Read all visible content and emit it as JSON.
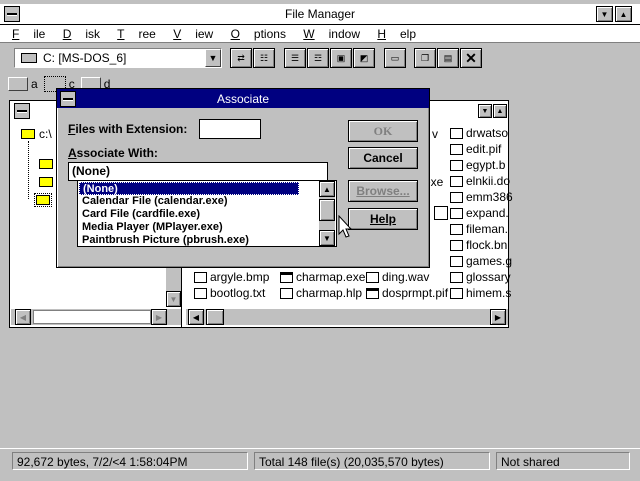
{
  "app": {
    "title": "File Manager"
  },
  "menu": [
    "File",
    "Disk",
    "Tree",
    "View",
    "Options",
    "Window",
    "Help"
  ],
  "menu_underline": [
    "F",
    "D",
    "T",
    "V",
    "O",
    "W",
    "H"
  ],
  "drive_select": {
    "value": "C: [MS-DOS_6]"
  },
  "drive_bar": {
    "drives": [
      "a",
      "c",
      "d"
    ]
  },
  "tree": {
    "root": "c:\\"
  },
  "files": {
    "col1": [
      "argyle.bmp",
      "bootlog.txt"
    ],
    "col2": [
      "charmap.exe",
      "charmap.hlp"
    ],
    "col3": [
      "ding.wav",
      "dosprmpt.pif"
    ],
    "col4": [
      "drwatso",
      "edit.pif",
      "egypt.b",
      "elnkii.do",
      "emm386",
      "expand.",
      "fileman.",
      "flock.bn",
      "games.g",
      "glossary",
      "himem.s"
    ],
    "partial": [
      "v",
      "exe"
    ]
  },
  "dialog": {
    "title": "Associate",
    "files_ext_label": "Files with Extension:",
    "files_ext_u": "F",
    "files_ext_value": "",
    "assoc_label": "Associate With:",
    "assoc_u": "A",
    "assoc_value": "(None)",
    "list": [
      "(None)",
      "Calendar File (calendar.exe)",
      "Card File (cardfile.exe)",
      "Media Player (MPlayer.exe)",
      "Paintbrush Picture (pbrush.exe)"
    ],
    "ok": "OK",
    "cancel": "Cancel",
    "browse": "Browse...",
    "help": "Help"
  },
  "status": {
    "selected": "92,672 bytes, 7/2/<4 1:58:04PM",
    "total": "Total 148 file(s) (20,035,570 bytes)",
    "share": "Not shared"
  }
}
